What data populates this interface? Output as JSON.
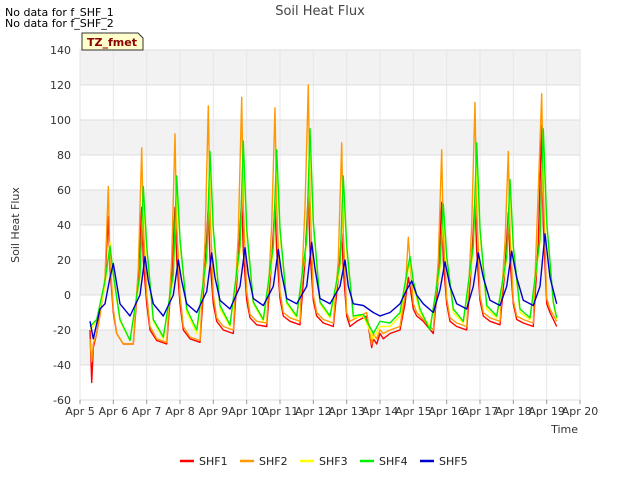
{
  "notes": [
    "No data for f_SHF_1",
    "No data for f_SHF_2"
  ],
  "badge": "TZ_fmet",
  "chart_data": {
    "type": "line",
    "title": "Soil Heat Flux",
    "xlabel": "Time",
    "ylabel": "Soil Heat Flux",
    "xlim": [
      5,
      20
    ],
    "ylim": [
      -60,
      140
    ],
    "x_ticks": [
      5,
      6,
      7,
      8,
      9,
      10,
      11,
      12,
      13,
      14,
      15,
      16,
      17,
      18,
      19,
      20
    ],
    "x_tick_labels": [
      "Apr 5",
      "Apr 6",
      "Apr 7",
      "Apr 8",
      "Apr 9",
      "Apr 10",
      "Apr 11",
      "Apr 12",
      "Apr 13",
      "Apr 14",
      "Apr 15",
      "Apr 16",
      "Apr 17",
      "Apr 18",
      "Apr 19",
      "Apr 20"
    ],
    "y_ticks": [
      -60,
      -40,
      -20,
      0,
      20,
      40,
      60,
      80,
      100,
      120,
      140
    ],
    "grid": true,
    "legend_position": "bottom",
    "series": [
      {
        "name": "SHF1",
        "color": "#ff0000",
        "x": [
          5.3,
          5.35,
          5.4,
          5.5,
          5.6,
          5.75,
          5.85,
          5.9,
          6.0,
          6.1,
          6.3,
          6.6,
          6.75,
          6.85,
          6.9,
          7.0,
          7.1,
          7.3,
          7.6,
          7.75,
          7.85,
          7.9,
          8.0,
          8.1,
          8.3,
          8.6,
          8.75,
          8.85,
          8.9,
          9.0,
          9.1,
          9.3,
          9.6,
          9.75,
          9.85,
          9.9,
          10.0,
          10.1,
          10.3,
          10.6,
          10.75,
          10.85,
          10.9,
          11.0,
          11.1,
          11.3,
          11.6,
          11.75,
          11.85,
          11.9,
          12.0,
          12.1,
          12.3,
          12.6,
          12.75,
          12.85,
          12.9,
          13.0,
          13.1,
          13.3,
          13.6,
          13.75,
          13.8,
          13.9,
          14.0,
          14.1,
          14.3,
          14.6,
          14.75,
          14.85,
          14.9,
          15.0,
          15.1,
          15.3,
          15.6,
          15.75,
          15.85,
          15.9,
          16.0,
          16.1,
          16.3,
          16.6,
          16.75,
          16.85,
          16.9,
          17.0,
          17.1,
          17.3,
          17.6,
          17.75,
          17.85,
          17.9,
          18.0,
          18.1,
          18.3,
          18.6,
          18.75,
          18.85,
          18.9,
          19.0,
          19.1,
          19.3
        ],
        "y": [
          -20,
          -50,
          -30,
          -22,
          -10,
          8,
          45,
          15,
          -10,
          -22,
          -28,
          -28,
          10,
          50,
          20,
          -5,
          -20,
          -26,
          -28,
          10,
          50,
          20,
          -5,
          -20,
          -25,
          -27,
          15,
          50,
          20,
          -5,
          -15,
          -20,
          -22,
          20,
          55,
          25,
          -3,
          -13,
          -17,
          -18,
          20,
          52,
          25,
          -2,
          -12,
          -15,
          -17,
          20,
          58,
          25,
          -3,
          -12,
          -16,
          -18,
          10,
          35,
          15,
          -12,
          -18,
          -15,
          -12,
          -30,
          -25,
          -28,
          -22,
          -25,
          -22,
          -20,
          -5,
          10,
          5,
          -8,
          -12,
          -15,
          -22,
          10,
          53,
          20,
          -5,
          -15,
          -18,
          -20,
          20,
          55,
          25,
          -3,
          -12,
          -15,
          -17,
          15,
          47,
          20,
          -5,
          -14,
          -16,
          -18,
          30,
          97,
          40,
          -5,
          -10,
          -18
        ]
      },
      {
        "name": "SHF2",
        "color": "#ff9900",
        "x": [
          5.3,
          5.35,
          5.4,
          5.5,
          5.6,
          5.75,
          5.85,
          5.9,
          6.0,
          6.1,
          6.3,
          6.6,
          6.75,
          6.85,
          6.9,
          7.0,
          7.1,
          7.3,
          7.6,
          7.75,
          7.85,
          7.9,
          8.0,
          8.1,
          8.3,
          8.6,
          8.75,
          8.85,
          8.9,
          9.0,
          9.1,
          9.3,
          9.6,
          9.75,
          9.85,
          9.9,
          10.0,
          10.1,
          10.3,
          10.6,
          10.75,
          10.85,
          10.9,
          11.0,
          11.1,
          11.3,
          11.6,
          11.75,
          11.85,
          11.9,
          12.0,
          12.1,
          12.3,
          12.6,
          12.75,
          12.85,
          12.9,
          13.0,
          13.1,
          13.3,
          13.6,
          13.75,
          13.8,
          13.9,
          14.0,
          14.1,
          14.3,
          14.6,
          14.75,
          14.85,
          14.9,
          15.0,
          15.1,
          15.3,
          15.6,
          15.75,
          15.85,
          15.9,
          16.0,
          16.1,
          16.3,
          16.6,
          16.75,
          16.85,
          16.9,
          17.0,
          17.1,
          17.3,
          17.6,
          17.75,
          17.85,
          17.9,
          18.0,
          18.1,
          18.3,
          18.6,
          18.75,
          18.85,
          18.9,
          19.0,
          19.1,
          19.3
        ],
        "y": [
          -25,
          -38,
          -28,
          -22,
          -12,
          10,
          62,
          20,
          -8,
          -22,
          -28,
          -28,
          15,
          84,
          40,
          0,
          -18,
          -25,
          -27,
          20,
          92,
          40,
          0,
          -18,
          -24,
          -26,
          30,
          108,
          50,
          0,
          -13,
          -18,
          -20,
          35,
          113,
          50,
          2,
          -11,
          -15,
          -16,
          40,
          107,
          50,
          2,
          -10,
          -13,
          -15,
          50,
          120,
          55,
          0,
          -10,
          -14,
          -16,
          20,
          87,
          35,
          -10,
          -15,
          -13,
          -10,
          -28,
          -22,
          -25,
          -20,
          -22,
          -20,
          -18,
          0,
          33,
          20,
          -5,
          -10,
          -14,
          -20,
          20,
          83,
          35,
          -2,
          -13,
          -16,
          -18,
          40,
          110,
          50,
          0,
          -10,
          -13,
          -15,
          30,
          82,
          35,
          -3,
          -12,
          -14,
          -16,
          60,
          115,
          60,
          -2,
          -8,
          -15
        ]
      },
      {
        "name": "SHF3",
        "color": "#ffff00",
        "x": [
          5.3,
          5.5,
          5.75,
          5.9,
          6.0,
          6.2,
          6.5,
          6.8,
          6.9,
          7.0,
          7.2,
          7.5,
          7.8,
          7.9,
          8.0,
          8.2,
          8.5,
          8.8,
          8.9,
          9.0,
          9.2,
          9.5,
          9.8,
          9.9,
          10.0,
          10.2,
          10.5,
          10.8,
          10.9,
          11.0,
          11.2,
          11.5,
          11.8,
          11.9,
          12.0,
          12.2,
          12.5,
          12.8,
          12.9,
          13.0,
          13.2,
          13.5,
          13.8,
          14.0,
          14.3,
          14.6,
          14.8,
          14.9,
          15.0,
          15.2,
          15.5,
          15.8,
          15.9,
          16.0,
          16.2,
          16.5,
          16.8,
          16.9,
          17.0,
          17.2,
          17.5,
          17.8,
          17.9,
          18.0,
          18.2,
          18.5,
          18.8,
          18.9,
          19.0,
          19.2,
          19.3
        ],
        "y": [
          -20,
          -15,
          5,
          30,
          10,
          -15,
          -26,
          10,
          55,
          25,
          -15,
          -25,
          10,
          60,
          30,
          -10,
          -22,
          20,
          75,
          35,
          -8,
          -18,
          25,
          80,
          35,
          -5,
          -15,
          25,
          78,
          35,
          -5,
          -13,
          30,
          85,
          40,
          -5,
          -13,
          15,
          60,
          25,
          -13,
          -12,
          -25,
          -18,
          -18,
          -12,
          10,
          20,
          5,
          -10,
          -18,
          15,
          45,
          20,
          -10,
          -16,
          25,
          75,
          35,
          -8,
          -13,
          20,
          60,
          25,
          -10,
          -14,
          30,
          85,
          40,
          -5,
          -14
        ]
      },
      {
        "name": "SHF4",
        "color": "#00ee00",
        "x": [
          5.3,
          5.5,
          5.75,
          5.9,
          6.0,
          6.2,
          6.5,
          6.8,
          6.9,
          7.0,
          7.2,
          7.5,
          7.8,
          7.9,
          8.0,
          8.2,
          8.5,
          8.8,
          8.9,
          9.0,
          9.2,
          9.5,
          9.8,
          9.9,
          10.0,
          10.2,
          10.5,
          10.8,
          10.9,
          11.0,
          11.2,
          11.5,
          11.8,
          11.9,
          12.0,
          12.2,
          12.5,
          12.8,
          12.9,
          13.0,
          13.2,
          13.5,
          13.8,
          14.0,
          14.3,
          14.6,
          14.8,
          14.9,
          15.0,
          15.2,
          15.5,
          15.8,
          15.9,
          16.0,
          16.2,
          16.5,
          16.8,
          16.9,
          17.0,
          17.2,
          17.5,
          17.8,
          17.9,
          18.0,
          18.2,
          18.5,
          18.8,
          18.9,
          19.0,
          19.2,
          19.3
        ],
        "y": [
          -18,
          -14,
          8,
          28,
          12,
          -14,
          -26,
          12,
          62,
          28,
          -14,
          -24,
          12,
          68,
          32,
          -8,
          -20,
          22,
          82,
          38,
          -6,
          -17,
          28,
          88,
          38,
          -4,
          -14,
          28,
          83,
          38,
          -4,
          -12,
          32,
          95,
          42,
          -4,
          -12,
          18,
          68,
          28,
          -12,
          -11,
          -22,
          -15,
          -16,
          -10,
          12,
          22,
          8,
          -8,
          -20,
          18,
          52,
          22,
          -8,
          -15,
          28,
          87,
          38,
          -6,
          -12,
          22,
          66,
          28,
          -8,
          -13,
          32,
          95,
          42,
          -4,
          -13
        ]
      },
      {
        "name": "SHF5",
        "color": "#0000cc",
        "x": [
          5.3,
          5.4,
          5.6,
          5.75,
          5.9,
          6.0,
          6.2,
          6.5,
          6.8,
          6.95,
          7.05,
          7.2,
          7.5,
          7.8,
          7.95,
          8.05,
          8.2,
          8.5,
          8.8,
          8.95,
          9.05,
          9.2,
          9.5,
          9.8,
          9.95,
          10.05,
          10.2,
          10.5,
          10.8,
          10.95,
          11.05,
          11.2,
          11.5,
          11.8,
          11.95,
          12.05,
          12.2,
          12.5,
          12.8,
          12.95,
          13.05,
          13.2,
          13.5,
          13.8,
          14.0,
          14.3,
          14.6,
          14.8,
          14.95,
          15.1,
          15.3,
          15.6,
          15.8,
          15.95,
          16.1,
          16.3,
          16.6,
          16.8,
          16.95,
          17.1,
          17.3,
          17.6,
          17.8,
          17.95,
          18.1,
          18.3,
          18.6,
          18.8,
          18.95,
          19.1,
          19.3
        ],
        "y": [
          -15,
          -25,
          -8,
          -5,
          10,
          18,
          -5,
          -12,
          0,
          22,
          8,
          -5,
          -12,
          0,
          20,
          8,
          -5,
          -10,
          2,
          24,
          10,
          -3,
          -8,
          5,
          27,
          12,
          -2,
          -6,
          5,
          26,
          12,
          -2,
          -5,
          5,
          30,
          15,
          -2,
          -5,
          5,
          20,
          5,
          -5,
          -6,
          -10,
          -12,
          -10,
          -5,
          3,
          8,
          0,
          -5,
          -10,
          3,
          19,
          5,
          -5,
          -8,
          5,
          24,
          10,
          -3,
          -6,
          5,
          25,
          10,
          -3,
          -6,
          5,
          35,
          10,
          -5
        ]
      }
    ]
  }
}
